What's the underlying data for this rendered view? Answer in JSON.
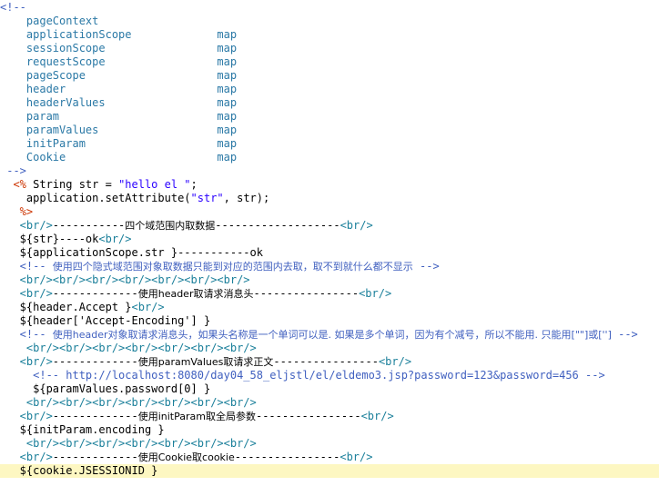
{
  "colors": {
    "comment": "#3f5fbf",
    "tag": "#1a7f9a",
    "text": "#000000",
    "string": "#2a00ff",
    "delimiter": "#cc3300",
    "current_line_highlight": "#fdf7c2"
  },
  "lines": [
    {
      "parts": [
        {
          "t": "<!--",
          "c": "c"
        }
      ]
    },
    {
      "parts": [
        {
          "t": "    pageContext",
          "c": "d"
        }
      ]
    },
    {
      "parts": [
        {
          "t": "    applicationScope             map",
          "c": "d"
        }
      ]
    },
    {
      "parts": [
        {
          "t": "    sessionScope                 map",
          "c": "d"
        }
      ]
    },
    {
      "parts": [
        {
          "t": "    requestScope                 map",
          "c": "d"
        }
      ]
    },
    {
      "parts": [
        {
          "t": "    pageScope                    map",
          "c": "d"
        }
      ]
    },
    {
      "parts": [
        {
          "t": "    header                       map",
          "c": "d"
        }
      ]
    },
    {
      "parts": [
        {
          "t": "    headerValues                 map",
          "c": "d"
        }
      ]
    },
    {
      "parts": [
        {
          "t": "    param                        map",
          "c": "d"
        }
      ]
    },
    {
      "parts": [
        {
          "t": "    paramValues                  map",
          "c": "d"
        }
      ]
    },
    {
      "parts": [
        {
          "t": "    initParam                    map",
          "c": "d"
        }
      ]
    },
    {
      "parts": [
        {
          "t": "    Cookie                       map",
          "c": "d"
        }
      ]
    },
    {
      "parts": [
        {
          "t": " -->",
          "c": "c"
        }
      ]
    },
    {
      "parts": [
        {
          "t": "  <%",
          "c": "m"
        },
        {
          "t": " String str = ",
          "c": "k"
        },
        {
          "t": "\"hello el \"",
          "c": "s"
        },
        {
          "t": ";",
          "c": "k"
        }
      ]
    },
    {
      "parts": [
        {
          "t": "    application.setAttribute(",
          "c": "k"
        },
        {
          "t": "\"str\"",
          "c": "s"
        },
        {
          "t": ", str);",
          "c": "k"
        }
      ]
    },
    {
      "parts": [
        {
          "t": "   %>",
          "c": "m"
        }
      ]
    },
    {
      "parts": [
        {
          "t": "   <br/>",
          "c": "g"
        },
        {
          "t": "-----------",
          "c": "k"
        },
        {
          "t": "四个域范围内取数据",
          "c": "k",
          "cn": true
        },
        {
          "t": "-------------------",
          "c": "k"
        },
        {
          "t": "<br/>",
          "c": "g"
        }
      ]
    },
    {
      "parts": [
        {
          "t": "   ${str}----ok",
          "c": "k"
        },
        {
          "t": "<br/>",
          "c": "g"
        }
      ]
    },
    {
      "parts": [
        {
          "t": "   ${applicationScope.str }-----------ok",
          "c": "k"
        }
      ]
    },
    {
      "parts": [
        {
          "t": "   <!-- ",
          "c": "c"
        },
        {
          "t": "使用四个隐式域范围对象取数据只能到对应的范围内去取，取不到就什么都不显示",
          "c": "c",
          "cn": true
        },
        {
          "t": " -->",
          "c": "c"
        }
      ]
    },
    {
      "parts": [
        {
          "t": "   <br/><br/><br/><br/><br/><br/><br/>",
          "c": "g"
        }
      ]
    },
    {
      "parts": [
        {
          "t": "   <br/>",
          "c": "g"
        },
        {
          "t": "-------------",
          "c": "k"
        },
        {
          "t": "使用header取请求消息头",
          "c": "k",
          "cn": true
        },
        {
          "t": "----------------",
          "c": "k"
        },
        {
          "t": "<br/>",
          "c": "g"
        }
      ]
    },
    {
      "parts": [
        {
          "t": "   ${header.Accept }",
          "c": "k"
        },
        {
          "t": "<br/>",
          "c": "g"
        }
      ]
    },
    {
      "parts": [
        {
          "t": "   ${header['Accept-Encoding'] }",
          "c": "k"
        }
      ]
    },
    {
      "parts": [
        {
          "t": "   <!-- ",
          "c": "c"
        },
        {
          "t": "使用header对象取请求消息头，如果头名称是一个单词可以是. 如果是多个单词，因为有个减号，所以不能用. 只能用[\"\"]或['']",
          "c": "c",
          "cn": true
        },
        {
          "t": " -->",
          "c": "c"
        }
      ]
    },
    {
      "parts": [
        {
          "t": "    <br/><br/><br/><br/><br/><br/><br/>",
          "c": "g"
        }
      ]
    },
    {
      "parts": [
        {
          "t": "   <br/>",
          "c": "g"
        },
        {
          "t": "-------------",
          "c": "k"
        },
        {
          "t": "使用paramValues取请求正文",
          "c": "k",
          "cn": true
        },
        {
          "t": "----------------",
          "c": "k"
        },
        {
          "t": "<br/>",
          "c": "g"
        }
      ]
    },
    {
      "parts": [
        {
          "t": "     <!-- http://localhost:8080/day04_58_eljstl/el/eldemo3.jsp?password=123&password=456 -->",
          "c": "c"
        }
      ]
    },
    {
      "parts": [
        {
          "t": "     ${paramValues.password[0] }",
          "c": "k"
        }
      ]
    },
    {
      "parts": [
        {
          "t": "    <br/><br/><br/><br/><br/><br/><br/>",
          "c": "g"
        }
      ]
    },
    {
      "parts": [
        {
          "t": "   <br/>",
          "c": "g"
        },
        {
          "t": "-------------",
          "c": "k"
        },
        {
          "t": "使用initParam取全局参数",
          "c": "k",
          "cn": true
        },
        {
          "t": "----------------",
          "c": "k"
        },
        {
          "t": "<br/>",
          "c": "g"
        }
      ]
    },
    {
      "parts": [
        {
          "t": "   ${initParam.encoding }",
          "c": "k"
        }
      ]
    },
    {
      "parts": [
        {
          "t": "    <br/><br/><br/><br/><br/><br/><br/>",
          "c": "g"
        }
      ]
    },
    {
      "parts": [
        {
          "t": "   <br/>",
          "c": "g"
        },
        {
          "t": "-------------",
          "c": "k"
        },
        {
          "t": "使用Cookie取cookie",
          "c": "k",
          "cn": true
        },
        {
          "t": "----------------",
          "c": "k"
        },
        {
          "t": "<br/>",
          "c": "g"
        }
      ]
    },
    {
      "parts": [
        {
          "t": "   ${cookie.JSESSIONID }",
          "c": "k"
        }
      ],
      "highlight": true
    }
  ]
}
